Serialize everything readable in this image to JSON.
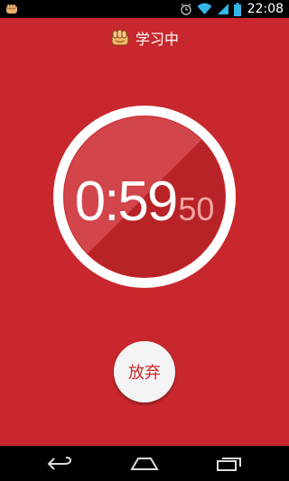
{
  "status_bar": {
    "time": "22:08",
    "icons": [
      "app-fist-icon",
      "alarm-icon",
      "wifi-icon",
      "signal-icon",
      "battery-icon"
    ]
  },
  "header": {
    "title": "学习中",
    "icon": "fist-icon"
  },
  "timer": {
    "main": "0:59",
    "centiseconds": "50"
  },
  "give_up_button": {
    "label": "放弃"
  },
  "nav_bar": {
    "buttons": [
      "back-icon",
      "home-icon",
      "recent-apps-icon"
    ]
  },
  "colors": {
    "background": "#c8282d",
    "ring": "#ffffff",
    "centiseconds": "#f0a6a3",
    "button_bg": "#f4f4f4",
    "button_text": "#c8282d"
  }
}
